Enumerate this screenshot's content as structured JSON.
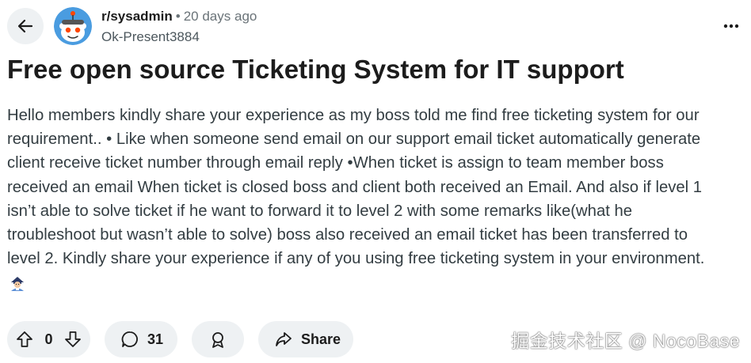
{
  "header": {
    "subreddit": "r/sysadmin",
    "separator": "•",
    "time_ago": "20 days ago",
    "author": "Ok-Present3884"
  },
  "post": {
    "title": "Free open source Ticketing System for IT support",
    "body_lines": [
      "Hello members kindly share your experience as my boss told me find free ticketing system for our",
      "requirement.. • Like when someone send email on our support email ticket automatically generate",
      "client receive ticket number through email reply •When ticket is assign to team member boss",
      "received an email When ticket is closed boss and client both received an Email. And also if level 1",
      "isn’t able to solve ticket if he want to forward it to level 2 with some remarks like(what he",
      "troubleshoot but wasn’t able to solve) boss also received an email ticket has been transferred to",
      "level 2. Kindly share your experience if any of you using free ticketing system in your environment."
    ]
  },
  "actions": {
    "vote_count": "0",
    "comment_count": "31",
    "share_label": "Share"
  },
  "icons": {
    "back": "arrow-left-icon",
    "more": "more-horizontal-icon",
    "upvote": "upvote-arrow-icon",
    "downvote": "downvote-arrow-icon",
    "comment": "comment-bubble-icon",
    "award": "award-icon",
    "share": "share-arrow-icon",
    "avatar": "reddit-snoo-avatar",
    "emoji": "person-emoji"
  },
  "colors": {
    "pill_bg": "#eef1f3",
    "avatar_bg": "#4a9ce0",
    "body_text": "#333d42",
    "meta_text": "#6a7378"
  },
  "watermark": "掘金技术社区 @ NocoBase"
}
